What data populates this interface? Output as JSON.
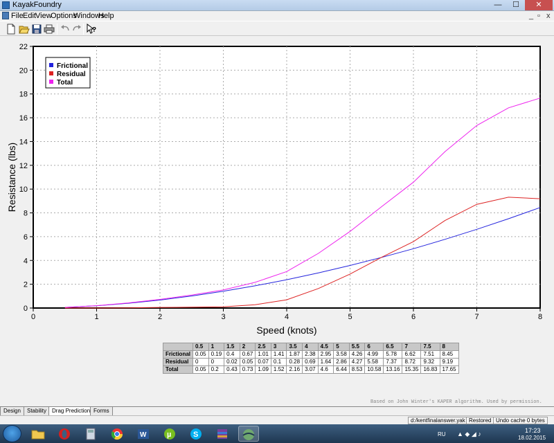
{
  "window": {
    "title": "KayakFoundry",
    "min_glyph": "—",
    "max_glyph": "☐",
    "close_glyph": "✕"
  },
  "menu": {
    "items": [
      {
        "label": "File"
      },
      {
        "label": "Edit"
      },
      {
        "label": "View"
      },
      {
        "label": "Options"
      },
      {
        "label": "Windows"
      },
      {
        "label": "Help"
      }
    ],
    "mdi_min": "_",
    "mdi_restore": "▫",
    "mdi_close": "x"
  },
  "toolbar": {
    "buttons": [
      "new-icon",
      "open-icon",
      "save-icon",
      "print-icon",
      "undo-icon",
      "redo-icon",
      "context-help-icon"
    ]
  },
  "chart_data": {
    "type": "line",
    "xlabel": "Speed (knots)",
    "ylabel": "Resistance (lbs)",
    "xlim": [
      0,
      8
    ],
    "ylim": [
      0,
      22
    ],
    "xticks": [
      0,
      1,
      2,
      3,
      4,
      5,
      6,
      7,
      8
    ],
    "yticks": [
      0,
      2,
      4,
      6,
      8,
      10,
      12,
      14,
      16,
      18,
      20,
      22
    ],
    "grid": true,
    "legend_position": "top-left",
    "x": [
      0.5,
      1,
      1.5,
      2,
      2.5,
      3,
      3.5,
      4,
      4.5,
      5,
      5.5,
      6,
      6.5,
      7,
      7.5,
      8
    ],
    "series": [
      {
        "name": "Frictional",
        "color": "#2222dd",
        "values": [
          0.05,
          0.19,
          0.4,
          0.67,
          1.01,
          1.41,
          1.87,
          2.38,
          2.95,
          3.58,
          4.26,
          4.99,
          5.78,
          6.62,
          7.51,
          8.45
        ]
      },
      {
        "name": "Residual",
        "color": "#dd2222",
        "values": [
          0,
          0,
          0.02,
          0.05,
          0.07,
          0.1,
          0.28,
          0.69,
          1.64,
          2.86,
          4.27,
          5.58,
          7.37,
          8.72,
          9.32,
          9.19
        ]
      },
      {
        "name": "Total",
        "color": "#ee22ee",
        "values": [
          0.05,
          0.2,
          0.43,
          0.73,
          1.09,
          1.52,
          2.16,
          3.07,
          4.6,
          6.44,
          8.53,
          10.58,
          13.16,
          15.35,
          16.83,
          17.65
        ]
      }
    ]
  },
  "table": {
    "headers": [
      "0.5",
      "1",
      "1.5",
      "2",
      "2.5",
      "3",
      "3.5",
      "4",
      "4.5",
      "5",
      "5.5",
      "6",
      "6.5",
      "7",
      "7.5",
      "8"
    ],
    "rows": [
      {
        "label": "Frictional",
        "cells": [
          "0.05",
          "0.19",
          "0.4",
          "0.67",
          "1.01",
          "1.41",
          "1.87",
          "2.38",
          "2.95",
          "3.58",
          "4.26",
          "4.99",
          "5.78",
          "6.62",
          "7.51",
          "8.45"
        ]
      },
      {
        "label": "Residual",
        "cells": [
          "0",
          "0",
          "0.02",
          "0.05",
          "0.07",
          "0.1",
          "0.28",
          "0.69",
          "1.64",
          "2.86",
          "4.27",
          "5.58",
          "7.37",
          "8.72",
          "9.32",
          "9.19"
        ]
      },
      {
        "label": "Total",
        "cells": [
          "0.05",
          "0.2",
          "0.43",
          "0.73",
          "1.09",
          "1.52",
          "2.16",
          "3.07",
          "4.6",
          "6.44",
          "8.53",
          "10.58",
          "13.16",
          "15.35",
          "16.83",
          "17.65"
        ]
      }
    ]
  },
  "credit": "Based on John Winter's KAPER algorithm.  Used by permission.",
  "tabs": [
    {
      "label": "Design",
      "active": false
    },
    {
      "label": "Stability",
      "active": false
    },
    {
      "label": "Drag Prediction",
      "active": true
    },
    {
      "label": "Forms",
      "active": false
    }
  ],
  "status": {
    "file": "d:/kentfinalanswer.yak",
    "state": "Restored",
    "undo": "Undo cache 0 bytes"
  },
  "taskbar": {
    "apps": [
      "folder-icon",
      "opera-icon",
      "calculator-icon",
      "chrome-icon",
      "word-icon",
      "utorrent-icon",
      "skype-icon",
      "winrar-icon",
      "kayakfoundry-icon"
    ],
    "lang": "RU",
    "time": "17:23",
    "date": "18.02.2015"
  }
}
